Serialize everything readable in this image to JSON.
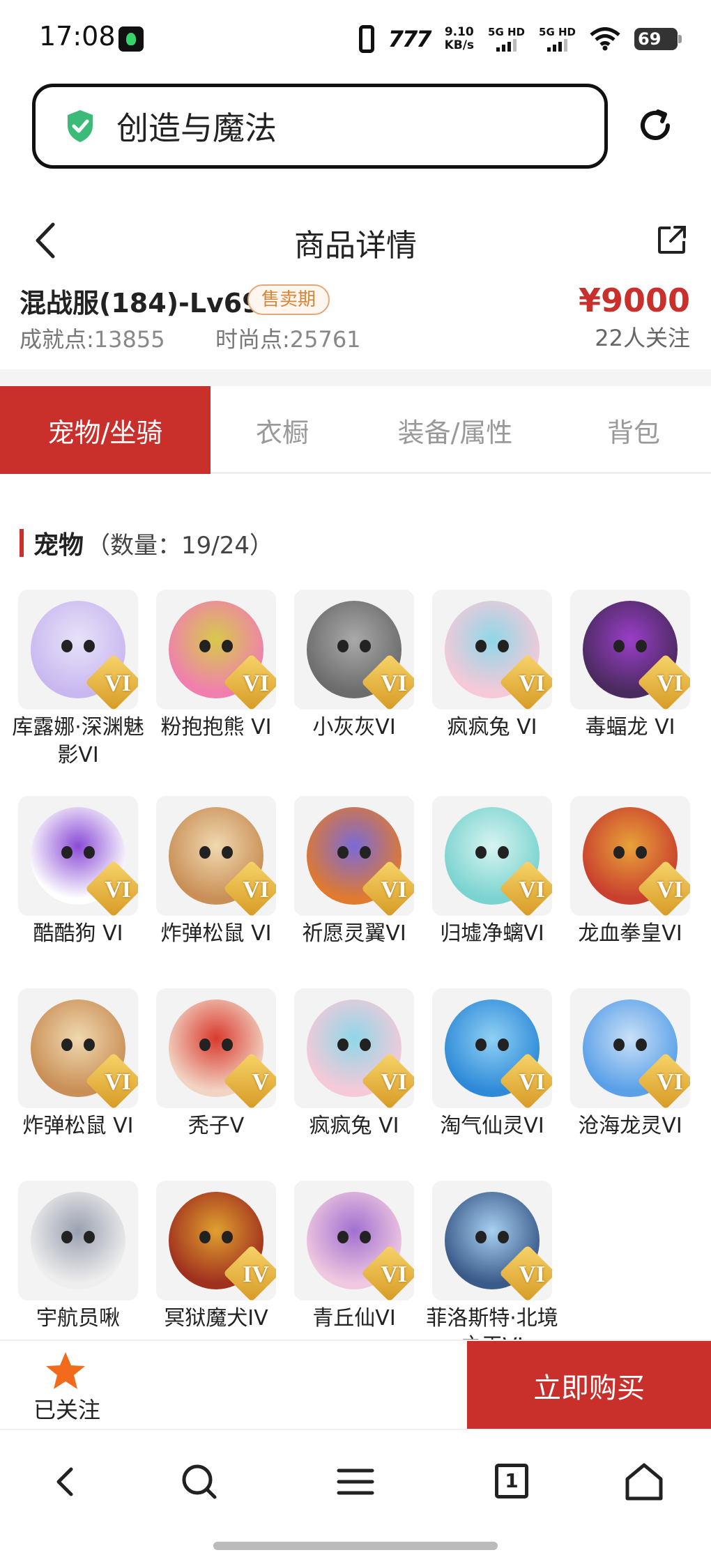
{
  "status_bar": {
    "time": "17:08",
    "net_speed_value": "9.10",
    "net_speed_unit": "KB/s",
    "sim1": "5G HD",
    "sim2": "5G HD",
    "battery": "69"
  },
  "browser": {
    "url_text": "创造与魔法"
  },
  "page": {
    "title": "商品详情"
  },
  "product": {
    "name": "混战服(184)-Lv69",
    "status_badge": "售卖期",
    "price": "¥9000",
    "achievement_label": "成就点:",
    "achievement_value": "13855",
    "fashion_label": "时尚点:",
    "fashion_value": "25761",
    "follow_count": "22人关注"
  },
  "tabs": [
    {
      "label": "宠物/坐骑",
      "active": true
    },
    {
      "label": "衣橱",
      "active": false
    },
    {
      "label": "装备/属性",
      "active": false
    },
    {
      "label": "背包",
      "active": false
    }
  ],
  "section": {
    "title": "宠物",
    "count_text": "（数量：19/24）"
  },
  "pets": [
    {
      "name": "库露娜·深渊魅影VI",
      "rank": "VI",
      "color": "#c9b8f0",
      "accent": "#e8e2f8"
    },
    {
      "name": "粉抱抱熊 VI",
      "rank": "VI",
      "color": "#f07fb0",
      "accent": "#d7c94a"
    },
    {
      "name": "小灰灰VI",
      "rank": "VI",
      "color": "#6c6c6c",
      "accent": "#a9a9a9"
    },
    {
      "name": "疯疯兔 VI",
      "rank": "VI",
      "color": "#f6c9d8",
      "accent": "#8fd7e8"
    },
    {
      "name": "毒蝠龙 VI",
      "rank": "VI",
      "color": "#4a2a5e",
      "accent": "#9a3ec9"
    },
    {
      "name": "酷酷狗 VI",
      "rank": "VI",
      "color": "#ffffff",
      "accent": "#8a4ad6"
    },
    {
      "name": "炸弹松鼠 VI",
      "rank": "VI",
      "color": "#c98f56",
      "accent": "#f0d8b0"
    },
    {
      "name": "祈愿灵翼VI",
      "rank": "VI",
      "color": "#e07a2e",
      "accent": "#7a6ad8"
    },
    {
      "name": "归墟净螭VI",
      "rank": "VI",
      "color": "#7ad3d0",
      "accent": "#d8f4f0"
    },
    {
      "name": "龙血拳皇VI",
      "rank": "VI",
      "color": "#c9402e",
      "accent": "#e8a23a"
    },
    {
      "name": "炸弹松鼠 VI",
      "rank": "VI",
      "color": "#c98f56",
      "accent": "#f0d8b0"
    },
    {
      "name": "秃子V",
      "rank": "V",
      "color": "#f2d4c4",
      "accent": "#d83a2e"
    },
    {
      "name": "疯疯兔 VI",
      "rank": "VI",
      "color": "#f6c9d8",
      "accent": "#8fd7e8"
    },
    {
      "name": "淘气仙灵VI",
      "rank": "VI",
      "color": "#2e8ad8",
      "accent": "#8fd0f4"
    },
    {
      "name": "沧海龙灵VI",
      "rank": "VI",
      "color": "#5aa0e8",
      "accent": "#c9e0f8"
    },
    {
      "name": "宇航员啾",
      "rank": "",
      "color": "#eeeeee",
      "accent": "#9aa0b0"
    },
    {
      "name": "冥狱魔犬IV",
      "rank": "IV",
      "color": "#a0301e",
      "accent": "#e0a030"
    },
    {
      "name": "青丘仙VI",
      "rank": "VI",
      "color": "#f0c8e0",
      "accent": "#a070d0"
    },
    {
      "name": "菲洛斯特·北境之王VI",
      "rank": "VI",
      "color": "#3a5a8a",
      "accent": "#a8d0f0"
    }
  ],
  "action_bar": {
    "followed_label": "已关注",
    "buy_label": "立即购买",
    "star_color": "#f26a1b"
  },
  "nav": {
    "tab_count": "1"
  },
  "colors": {
    "accent_red": "#c9302c",
    "badge_orange": "#d98539"
  }
}
